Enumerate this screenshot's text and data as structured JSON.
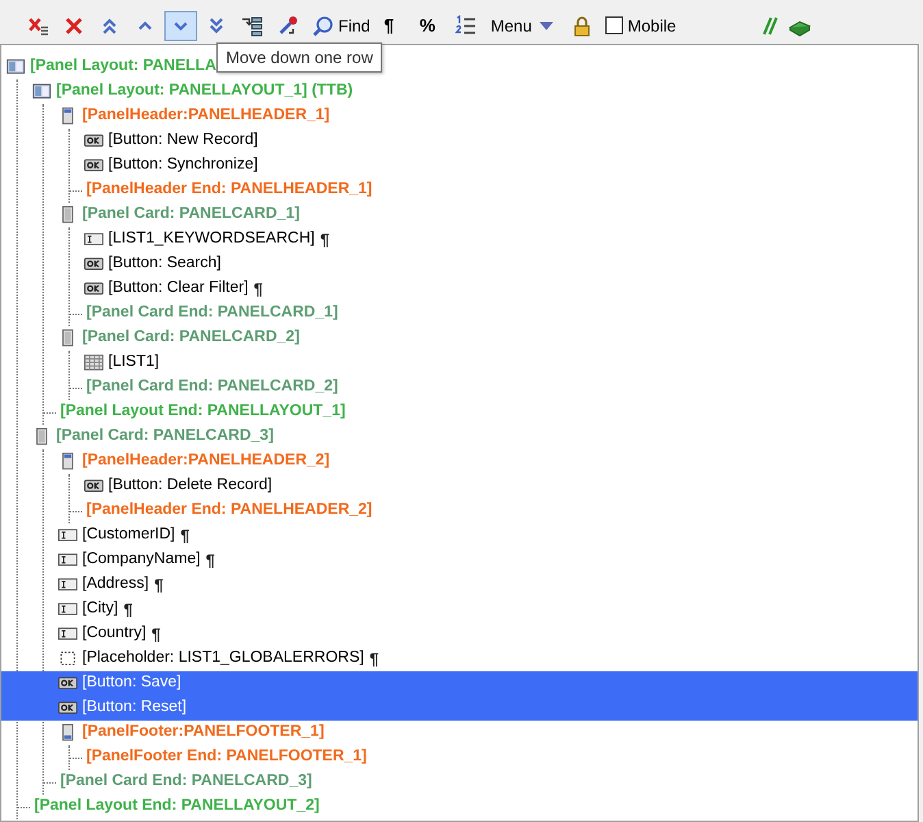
{
  "toolbar": {
    "buttons": [
      {
        "selected": false
      },
      {
        "selected": false
      },
      {
        "selected": false
      },
      {
        "selected": false
      },
      {
        "selected": true
      },
      {
        "selected": false
      },
      {
        "selected": false
      },
      {
        "selected": false
      },
      {
        "selected": false,
        "label": "Find"
      },
      {
        "selected": false,
        "label": "¶"
      },
      {
        "selected": false,
        "label": "%"
      },
      {
        "selected": false
      },
      {
        "selected": false,
        "label": "Menu"
      },
      {
        "selected": false
      }
    ],
    "mobile": {
      "label": "Mobile",
      "checked": false
    },
    "tooltip": "Move down one row"
  },
  "tree": [
    {
      "kind": "layout",
      "label": "[Panel Layout: PANELLA",
      "selected": false,
      "children": [
        {
          "kind": "layout",
          "label": "[Panel Layout: PANELLAYOUT_1] (TTB)",
          "selected": false,
          "children": [
            {
              "kind": "header",
              "label": "[PanelHeader:PANELHEADER_1]",
              "selected": false,
              "children": [
                {
                  "kind": "button",
                  "label": "[Button: New Record]",
                  "selected": false
                },
                {
                  "kind": "button",
                  "label": "[Button: Synchronize]",
                  "selected": false
                },
                {
                  "kind": "end",
                  "label": "[PanelHeader End: PANELHEADER_1]",
                  "selected": false
                }
              ]
            },
            {
              "kind": "card",
              "label": "[Panel Card: PANELCARD_1]",
              "selected": false,
              "children": [
                {
                  "kind": "field",
                  "label": "[LIST1_KEYWORDSEARCH]",
                  "mark": "¶",
                  "selected": false
                },
                {
                  "kind": "button",
                  "label": "[Button: Search]",
                  "selected": false
                },
                {
                  "kind": "button",
                  "label": "[Button: Clear Filter]",
                  "mark": "¶",
                  "selected": false
                },
                {
                  "kind": "end",
                  "label": "[Panel Card End: PANELCARD_1]",
                  "selected": false
                }
              ]
            },
            {
              "kind": "card",
              "label": "[Panel Card: PANELCARD_2]",
              "selected": false,
              "children": [
                {
                  "kind": "grid",
                  "label": "[LIST1]",
                  "selected": false
                },
                {
                  "kind": "end",
                  "label": "[Panel Card End: PANELCARD_2]",
                  "selected": false
                }
              ]
            },
            {
              "kind": "end",
              "label": "[Panel Layout End: PANELLAYOUT_1]",
              "selected": false
            }
          ]
        },
        {
          "kind": "card",
          "label": "[Panel Card: PANELCARD_3]",
          "selected": false,
          "children": [
            {
              "kind": "header",
              "label": "[PanelHeader:PANELHEADER_2]",
              "selected": false,
              "children": [
                {
                  "kind": "button",
                  "label": "[Button: Delete Record]",
                  "selected": false
                },
                {
                  "kind": "end",
                  "label": "[PanelHeader End: PANELHEADER_2]",
                  "selected": false
                }
              ]
            },
            {
              "kind": "field",
              "label": "[CustomerID]",
              "mark": "¶",
              "selected": false
            },
            {
              "kind": "field",
              "label": "[CompanyName]",
              "mark": "¶",
              "selected": false
            },
            {
              "kind": "field",
              "label": "[Address]",
              "mark": "¶",
              "selected": false
            },
            {
              "kind": "field",
              "label": "[City]",
              "mark": "¶",
              "selected": false
            },
            {
              "kind": "field",
              "label": "[Country]",
              "mark": "¶",
              "selected": false
            },
            {
              "kind": "placeholder",
              "label": "[Placeholder: LIST1_GLOBALERRORS]",
              "mark": "¶",
              "selected": false
            },
            {
              "kind": "button",
              "label": "[Button: Save]",
              "selected": true
            },
            {
              "kind": "button",
              "label": "[Button: Reset]",
              "selected": true
            },
            {
              "kind": "footer",
              "label": "[PanelFooter:PANELFOOTER_1]",
              "selected": false,
              "children": [
                {
                  "kind": "end",
                  "label": "[PanelFooter End: PANELFOOTER_1]",
                  "selected": false
                }
              ]
            },
            {
              "kind": "end",
              "label": "[Panel Card End: PANELCARD_3]",
              "selected": false
            }
          ]
        },
        {
          "kind": "end",
          "label": "[Panel Layout End: PANELLAYOUT_2]",
          "selected": false
        }
      ]
    }
  ]
}
